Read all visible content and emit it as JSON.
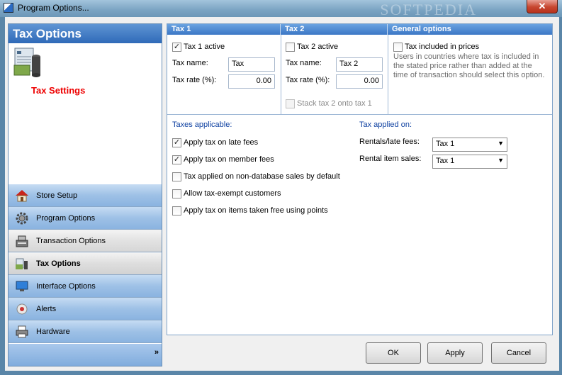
{
  "window": {
    "title": "Program Options...",
    "close": "✕"
  },
  "watermark": "SOFTPEDIA",
  "sidebar": {
    "header": "Tax Options",
    "page_title": "Tax Settings",
    "items": [
      {
        "label": "Store Setup",
        "icon": "house-icon"
      },
      {
        "label": "Program Options",
        "icon": "gear-icon"
      },
      {
        "label": "Transaction Options",
        "icon": "cash-register-icon"
      },
      {
        "label": "Tax Options",
        "icon": "money-icon",
        "active": true
      },
      {
        "label": "Interface Options",
        "icon": "monitor-icon"
      },
      {
        "label": "Alerts",
        "icon": "alert-icon"
      },
      {
        "label": "Hardware",
        "icon": "printer-icon"
      }
    ],
    "more": "»"
  },
  "tax1": {
    "header": "Tax 1",
    "active_label": "Tax 1 active",
    "active": true,
    "name_label": "Tax name:",
    "name_value": "Tax",
    "rate_label": "Tax rate (%):",
    "rate_value": "0.00"
  },
  "tax2": {
    "header": "Tax 2",
    "active_label": "Tax 2 active",
    "active": false,
    "name_label": "Tax name:",
    "name_value": "Tax 2",
    "rate_label": "Tax rate (%):",
    "rate_value": "0.00",
    "stack_label": "Stack tax 2 onto tax 1"
  },
  "general": {
    "header": "General options",
    "included_label": "Tax included in prices",
    "description": "Users in countries where tax is included in the stated price rather than added at the time of transaction should select this option."
  },
  "applicable": {
    "header": "Taxes applicable:",
    "items": [
      {
        "label": "Apply tax on late fees",
        "checked": true
      },
      {
        "label": "Apply tax on member fees",
        "checked": true
      },
      {
        "label": "Tax applied on non-database sales by default",
        "checked": false
      },
      {
        "label": "Allow tax-exempt customers",
        "checked": false
      },
      {
        "label": "Apply tax on items taken free using points",
        "checked": false
      }
    ]
  },
  "applied_on": {
    "header": "Tax applied on:",
    "rentals_label": "Rentals/late fees:",
    "rentals_value": "Tax 1",
    "items_label": "Rental item sales:",
    "items_value": "Tax 1"
  },
  "buttons": {
    "ok": "OK",
    "apply": "Apply",
    "cancel": "Cancel"
  },
  "check_mark": "✓"
}
